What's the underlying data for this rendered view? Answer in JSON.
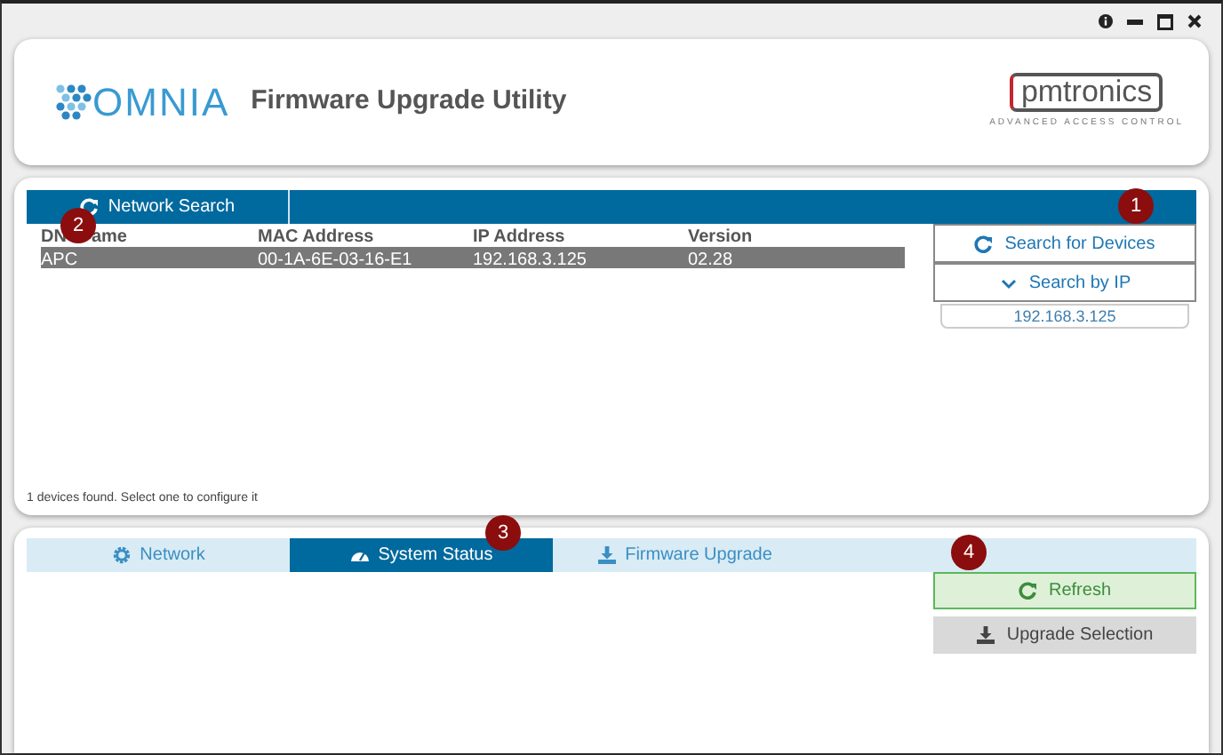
{
  "header": {
    "logo_text": "OMNIA",
    "title": "Firmware Upgrade Utility",
    "brand_text": "pmtronics",
    "brand_tagline": "ADVANCED ACCESS CONTROL"
  },
  "search_panel": {
    "tab": "Network Search",
    "columns": [
      {
        "label": "DN",
        "label_after_callout": "ame"
      },
      {
        "label": "MAC Address"
      },
      {
        "label": "IP Address"
      },
      {
        "label": "Version"
      }
    ],
    "rows": [
      {
        "selected": true,
        "cells": [
          "APC",
          "00-1A-6E-03-16-E1",
          "192.168.3.125",
          "02.28"
        ]
      }
    ],
    "buttons": [
      {
        "kind": "refresh",
        "label": "Search for Devices"
      },
      {
        "kind": "caret",
        "label": "Search by IP"
      }
    ],
    "ip_field": {
      "value": "192.168.3.125"
    },
    "status": "1 devices found. Select one to configure it"
  },
  "config_panel": {
    "tabs": [
      {
        "kind": "gear",
        "label": "Network",
        "selected": false
      },
      {
        "kind": "gauge",
        "label": "System Status",
        "selected": true
      },
      {
        "kind": "download",
        "label": "Firmware Upgrade",
        "selected": false
      }
    ],
    "actions": [
      {
        "kind": "refresh",
        "label": "Refresh"
      },
      {
        "kind": "download",
        "label": "Upgrade Selection"
      }
    ]
  },
  "callouts": [
    "1",
    "2",
    "3",
    "4"
  ]
}
